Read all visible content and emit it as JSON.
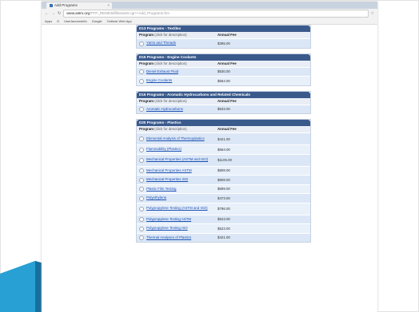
{
  "browser": {
    "tab_title": "Add Programs",
    "tab_close": "×",
    "url_host": "www.astm.org",
    "url_path": "/PTP_RENEW/fillnew40.cgi?+Add_Programs.frm",
    "bookmarks": [
      "Apps",
      "G",
      "Userlacconsinfo",
      "Google",
      "Outlook Web App"
    ]
  },
  "table_headers": {
    "program": "Program",
    "program_hint": "(click for description)",
    "fee": "Annual Fee"
  },
  "sections": [
    {
      "title": "D13 Programs - Textiles",
      "rows": [
        {
          "name": "Yarns and Threads",
          "fee": "$395.00",
          "lines": 1
        }
      ]
    },
    {
      "title": "D15 Programs - Engine Coolants",
      "rows": [
        {
          "name": "Diesel Exhaust Fluid",
          "fee": "$530.00",
          "lines": 1
        },
        {
          "name": "Engine Coolants",
          "fee": "$554.00",
          "lines": 1
        }
      ]
    },
    {
      "title": "D16 Programs - Aromatic Hydrocarbons and Related Chemicals",
      "rows": [
        {
          "name": "Aromatic Hydrocarbons",
          "fee": "$633.00",
          "lines": 1
        }
      ]
    },
    {
      "title": "D20 Programs - Plastics",
      "rows": [
        {
          "name": "Elemental Analysis of Thermoplastics",
          "fee": "$421.00",
          "lines": 2
        },
        {
          "name": "Flammability (Plastics)",
          "fee": "$664.00",
          "lines": 1
        },
        {
          "name": "Mechanical Properties (ASTM and ISO)",
          "fee": "$1105.00",
          "lines": 2
        },
        {
          "name": "Mechanical Properties ASTM",
          "fee": "$808.00",
          "lines": 1
        },
        {
          "name": "Mechanical Properties ISO",
          "fee": "$808.00",
          "lines": 1
        },
        {
          "name": "Plastic Film Testing",
          "fee": "$699.00",
          "lines": 1
        },
        {
          "name": "Polyethylene",
          "fee": "$473.00",
          "lines": 1
        },
        {
          "name": "Polypropylene Testing (ASTM and ISO)",
          "fee": "$786.00",
          "lines": 2
        },
        {
          "name": "Polypropylene Testing ASTM",
          "fee": "$523.00",
          "lines": 1
        },
        {
          "name": "Polypropylene Testing ISO",
          "fee": "$523.00",
          "lines": 1
        },
        {
          "name": "Thermal Analyses of Plastics",
          "fee": "$421.00",
          "lines": 1
        }
      ]
    }
  ],
  "colors": {
    "section_header": "#3a5a8c",
    "row_bg": "#dbe7f6",
    "link": "#1a4fb3",
    "slide_accent": "#1f8fc3"
  }
}
